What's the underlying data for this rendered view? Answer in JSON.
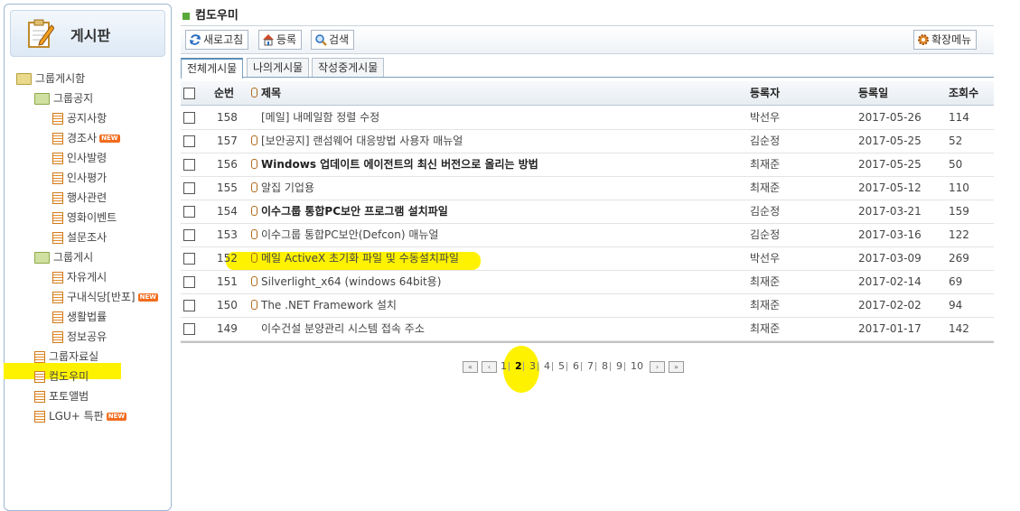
{
  "sidebar": {
    "title": "게시판",
    "tree": [
      {
        "label": "그룹게시함",
        "type": "folder",
        "new": false
      },
      {
        "label": "그룹공지",
        "type": "folder",
        "new": false
      },
      {
        "label": "공지사항",
        "type": "doc",
        "new": false
      },
      {
        "label": "경조사",
        "type": "doc",
        "new": true
      },
      {
        "label": "인사발령",
        "type": "doc",
        "new": false
      },
      {
        "label": "인사평가",
        "type": "doc",
        "new": false
      },
      {
        "label": "행사관련",
        "type": "doc",
        "new": false
      },
      {
        "label": "영화이벤트",
        "type": "doc",
        "new": false
      },
      {
        "label": "설문조사",
        "type": "doc",
        "new": false
      },
      {
        "label": "그룹게시",
        "type": "folder",
        "new": false
      },
      {
        "label": "자유게시",
        "type": "doc",
        "new": false
      },
      {
        "label": "구내식당[반포]",
        "type": "doc",
        "new": true
      },
      {
        "label": "생활법률",
        "type": "doc",
        "new": false
      },
      {
        "label": "정보공유",
        "type": "doc",
        "new": false
      },
      {
        "label": "그룹자료실",
        "type": "doc",
        "new": false
      },
      {
        "label": "컴도우미",
        "type": "doc",
        "new": false
      },
      {
        "label": "포토앨범",
        "type": "doc",
        "new": false
      },
      {
        "label": "LGU+ 특판",
        "type": "doc",
        "new": true
      }
    ],
    "new_badge": "NEW"
  },
  "header": {
    "board_name": "컴도우미"
  },
  "toolbar": {
    "refresh": "새로고침",
    "register": "등록",
    "search": "검색",
    "extend_menu": "확장메뉴"
  },
  "tabs": [
    "전체게시물",
    "나의게시물",
    "작성중게시물"
  ],
  "table": {
    "columns": {
      "num": "순번",
      "title": "제목",
      "author": "등록자",
      "date": "등록일",
      "views": "조회수"
    },
    "rows": [
      {
        "num": "158",
        "clip": false,
        "bold": false,
        "title": "[메일] 내메일함 정렬 수정",
        "author": "박선우",
        "date": "2017-05-26",
        "views": "114"
      },
      {
        "num": "157",
        "clip": true,
        "bold": false,
        "title": "[보안공지] 랜섬웨어 대응방법 사용자 매뉴얼",
        "author": "김순정",
        "date": "2017-05-25",
        "views": "52"
      },
      {
        "num": "156",
        "clip": true,
        "bold": true,
        "title": "Windows 업데이트 에이전트의 최신 버전으로 올리는 방법",
        "author": "최재준",
        "date": "2017-05-25",
        "views": "50"
      },
      {
        "num": "155",
        "clip": true,
        "bold": false,
        "title": "알집 기업용",
        "author": "최재준",
        "date": "2017-05-12",
        "views": "110"
      },
      {
        "num": "154",
        "clip": true,
        "bold": true,
        "title": "이수그룹 통합PC보안 프로그램 설치파일",
        "author": "김순정",
        "date": "2017-03-21",
        "views": "159"
      },
      {
        "num": "153",
        "clip": true,
        "bold": false,
        "title": "이수그룹 통합PC보안(Defcon) 매뉴얼",
        "author": "김순정",
        "date": "2017-03-16",
        "views": "122"
      },
      {
        "num": "152",
        "clip": true,
        "bold": false,
        "title": "메일 ActiveX 초기화 파일 및 수동설치파일",
        "author": "박선우",
        "date": "2017-03-09",
        "views": "269"
      },
      {
        "num": "151",
        "clip": true,
        "bold": false,
        "title": "Silverlight_x64 (windows 64bit용)",
        "author": "최재준",
        "date": "2017-02-14",
        "views": "69"
      },
      {
        "num": "150",
        "clip": true,
        "bold": false,
        "title": "The .NET Framework 설치",
        "author": "최재준",
        "date": "2017-02-02",
        "views": "94"
      },
      {
        "num": "149",
        "clip": false,
        "bold": false,
        "title": "이수건설 분양관리 시스템 접속 주소",
        "author": "최재준",
        "date": "2017-01-17",
        "views": "142"
      }
    ]
  },
  "pager": {
    "pages": [
      "1",
      "2",
      "3",
      "4",
      "5",
      "6",
      "7",
      "8",
      "9",
      "10"
    ],
    "current": "2"
  },
  "colors": {
    "highlight": "#fff200",
    "new_badge": "#f26c1e",
    "accent_green": "#58a83a"
  }
}
